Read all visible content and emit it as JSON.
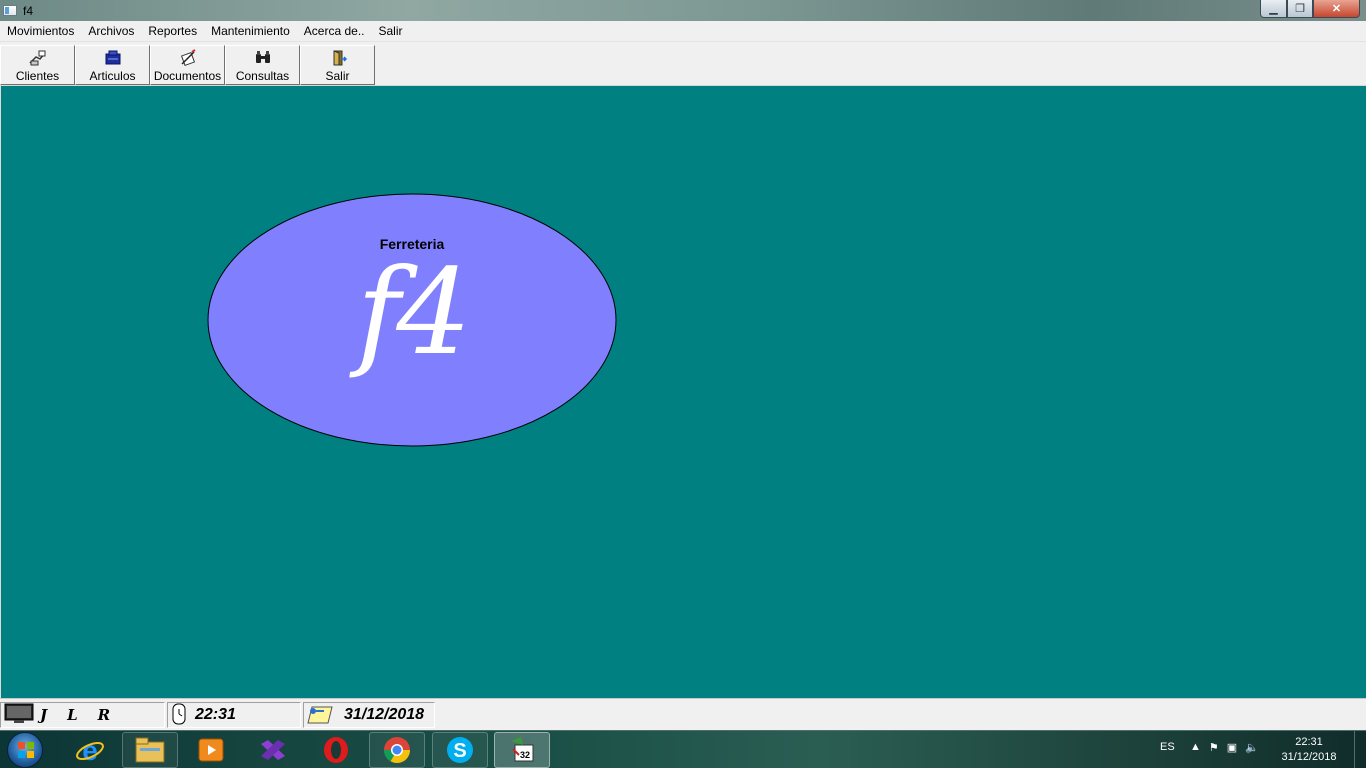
{
  "window": {
    "title": "f4",
    "min_glyph": "▁",
    "max_glyph": "❐",
    "close_glyph": "✕"
  },
  "menu": [
    "Movimientos",
    "Archivos",
    "Reportes",
    "Mantenimiento",
    "Acerca de..",
    "Salir"
  ],
  "toolbar": {
    "buttons": [
      {
        "label": "Clientes",
        "icon": "clients-icon"
      },
      {
        "label": "Articulos",
        "icon": "articles-icon"
      },
      {
        "label": "Documentos",
        "icon": "documents-icon"
      },
      {
        "label": "Consultas",
        "icon": "binoculars-icon"
      },
      {
        "label": "Salir",
        "icon": "exit-door-icon"
      }
    ]
  },
  "logo": {
    "subtitle": "Ferreteria",
    "text": "f4",
    "fill": "#8080ff"
  },
  "statusbar": {
    "letters": [
      "J",
      "L",
      "R"
    ],
    "time": "22:31",
    "date": "31/12/2018"
  },
  "taskbar": {
    "apps": [
      "internet-explorer-icon",
      "file-explorer-icon",
      "media-player-icon",
      "visual-studio-icon",
      "opera-icon",
      "chrome-icon",
      "skype-icon",
      "f4-app-icon"
    ],
    "language": "ES",
    "tray_time": "22:31",
    "tray_date": "31/12/2018"
  },
  "colors": {
    "mdi_background": "#008080",
    "chrome": "#f0f0f0"
  }
}
